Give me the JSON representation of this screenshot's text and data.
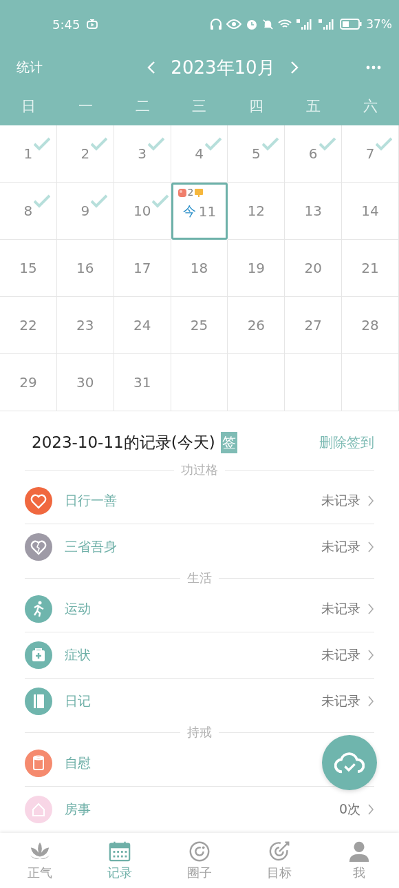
{
  "status_bar": {
    "time": "5:45",
    "battery": "37%"
  },
  "header": {
    "left": "统计",
    "month": "2023年10月"
  },
  "weekdays": [
    "日",
    "一",
    "二",
    "三",
    "四",
    "五",
    "六"
  ],
  "days": [
    {
      "day": "1",
      "checked": true,
      "selected": false
    },
    {
      "day": "2",
      "checked": true,
      "selected": false
    },
    {
      "day": "3",
      "checked": true,
      "selected": false
    },
    {
      "day": "4",
      "checked": true,
      "selected": false
    },
    {
      "day": "5",
      "checked": true,
      "selected": false
    },
    {
      "day": "6",
      "checked": true,
      "selected": false
    },
    {
      "day": "7",
      "checked": true,
      "selected": false
    },
    {
      "day": "8",
      "checked": true,
      "selected": false
    },
    {
      "day": "9",
      "checked": true,
      "selected": false
    },
    {
      "day": "10",
      "checked": true,
      "selected": false
    },
    {
      "day": "11",
      "checked": false,
      "selected": true,
      "today_label": "今",
      "count": "2"
    },
    {
      "day": "12",
      "checked": false,
      "selected": false
    },
    {
      "day": "13",
      "checked": false,
      "selected": false
    },
    {
      "day": "14",
      "checked": false,
      "selected": false
    },
    {
      "day": "15",
      "checked": false,
      "selected": false
    },
    {
      "day": "16",
      "checked": false,
      "selected": false
    },
    {
      "day": "17",
      "checked": false,
      "selected": false
    },
    {
      "day": "18",
      "checked": false,
      "selected": false
    },
    {
      "day": "19",
      "checked": false,
      "selected": false
    },
    {
      "day": "20",
      "checked": false,
      "selected": false
    },
    {
      "day": "21",
      "checked": false,
      "selected": false
    },
    {
      "day": "22",
      "checked": false,
      "selected": false
    },
    {
      "day": "23",
      "checked": false,
      "selected": false
    },
    {
      "day": "24",
      "checked": false,
      "selected": false
    },
    {
      "day": "25",
      "checked": false,
      "selected": false
    },
    {
      "day": "26",
      "checked": false,
      "selected": false
    },
    {
      "day": "27",
      "checked": false,
      "selected": false
    },
    {
      "day": "28",
      "checked": false,
      "selected": false
    },
    {
      "day": "29",
      "checked": false,
      "selected": false
    },
    {
      "day": "30",
      "checked": false,
      "selected": false
    },
    {
      "day": "31",
      "checked": false,
      "selected": false
    }
  ],
  "record": {
    "title": "2023-10-11的记录(今天)",
    "sign_badge": "签",
    "delete_link": "删除签到"
  },
  "sections": [
    {
      "title": "功过格",
      "items": [
        {
          "label": "日行一善",
          "value": "未记录",
          "color": "#f0683f"
        },
        {
          "label": "三省吾身",
          "value": "未记录",
          "color": "#9e9aa6"
        }
      ]
    },
    {
      "title": "生活",
      "items": [
        {
          "label": "运动",
          "value": "未记录",
          "color": "#6fb5ad"
        },
        {
          "label": "症状",
          "value": "未记录",
          "color": "#6fb5ad"
        },
        {
          "label": "日记",
          "value": "未记录",
          "color": "#6fb5ad"
        }
      ]
    },
    {
      "title": "持戒",
      "items": [
        {
          "label": "自慰",
          "color": "#f58a6e"
        },
        {
          "label": "房事",
          "value": "0次",
          "color": "#f8d6e6"
        }
      ]
    }
  ],
  "nav": [
    {
      "label": "正气",
      "selected": false
    },
    {
      "label": "记录",
      "selected": true
    },
    {
      "label": "圈子",
      "selected": false
    },
    {
      "label": "目标",
      "selected": false
    },
    {
      "label": "我",
      "selected": false
    }
  ]
}
